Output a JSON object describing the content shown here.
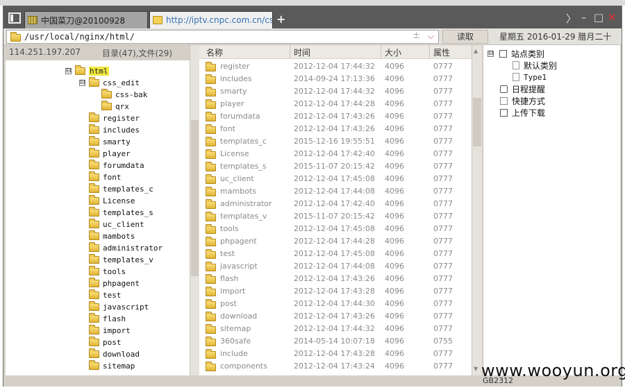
{
  "window": {
    "tabs": [
      {
        "label": "中国菜刀@20100928"
      },
      {
        "label": "http://iptv.cnpc.com.cn/css_..."
      }
    ],
    "new_tab_label": "+",
    "controls": {
      "forward": "〉",
      "minimize": "–",
      "maximize": "□",
      "close": "✕"
    }
  },
  "address_bar": {
    "path": "/usr/local/nginx/html/",
    "mid_symbol": "±",
    "dropdown": "⌵",
    "go_label": "读取",
    "date": "星期五  2016-01-29 腊月二十"
  },
  "info": {
    "ip": "114.251.197.207",
    "counts": "目录(47),文件(29)"
  },
  "tree": {
    "expander": "⊟",
    "items": [
      {
        "label": "html",
        "level": 0,
        "expanded": true,
        "selected": true
      },
      {
        "label": "css_edit",
        "level": 1,
        "expanded": true
      },
      {
        "label": "css-bak",
        "level": 2
      },
      {
        "label": "qrx",
        "level": 2
      },
      {
        "label": "register",
        "level": 1
      },
      {
        "label": "includes",
        "level": 1
      },
      {
        "label": "smarty",
        "level": 1
      },
      {
        "label": "player",
        "level": 1
      },
      {
        "label": "forumdata",
        "level": 1
      },
      {
        "label": "font",
        "level": 1
      },
      {
        "label": "templates_c",
        "level": 1
      },
      {
        "label": "License",
        "level": 1
      },
      {
        "label": "templates_s",
        "level": 1
      },
      {
        "label": "uc_client",
        "level": 1
      },
      {
        "label": "mambots",
        "level": 1
      },
      {
        "label": "administrator",
        "level": 1
      },
      {
        "label": "templates_v",
        "level": 1
      },
      {
        "label": "tools",
        "level": 1
      },
      {
        "label": "phpagent",
        "level": 1
      },
      {
        "label": "test",
        "level": 1
      },
      {
        "label": "javascript",
        "level": 1
      },
      {
        "label": "flash",
        "level": 1
      },
      {
        "label": "import",
        "level": 1
      },
      {
        "label": "post",
        "level": 1
      },
      {
        "label": "download",
        "level": 1
      },
      {
        "label": "sitemap",
        "level": 1
      }
    ]
  },
  "file_list": {
    "columns": {
      "name": "名称",
      "time": "时间",
      "size": "大小",
      "attr": "属性"
    },
    "rows": [
      {
        "name": "register",
        "time": "2012-12-04 17:44:32",
        "size": "4096",
        "attr": "0777"
      },
      {
        "name": "includes",
        "time": "2014-09-24 17:13:36",
        "size": "4096",
        "attr": "0777"
      },
      {
        "name": "smarty",
        "time": "2012-12-04 17:44:32",
        "size": "4096",
        "attr": "0777"
      },
      {
        "name": "player",
        "time": "2012-12-04 17:44:28",
        "size": "4096",
        "attr": "0777"
      },
      {
        "name": "forumdata",
        "time": "2012-12-04 17:43:26",
        "size": "4096",
        "attr": "0777"
      },
      {
        "name": "font",
        "time": "2012-12-04 17:43:26",
        "size": "4096",
        "attr": "0777"
      },
      {
        "name": "templates_c",
        "time": "2015-12-16 19:55:51",
        "size": "4096",
        "attr": "0777"
      },
      {
        "name": "License",
        "time": "2012-12-04 17:42:40",
        "size": "4096",
        "attr": "0777"
      },
      {
        "name": "templates_s",
        "time": "2015-11-07 20:15:42",
        "size": "4096",
        "attr": "0777"
      },
      {
        "name": "uc_client",
        "time": "2012-12-04 17:45:08",
        "size": "4096",
        "attr": "0777"
      },
      {
        "name": "mambots",
        "time": "2012-12-04 17:44:08",
        "size": "4096",
        "attr": "0777"
      },
      {
        "name": "administrator",
        "time": "2012-12-04 17:42:40",
        "size": "4096",
        "attr": "0777"
      },
      {
        "name": "templates_v",
        "time": "2015-11-07 20:15:42",
        "size": "4096",
        "attr": "0777"
      },
      {
        "name": "tools",
        "time": "2012-12-04 17:45:08",
        "size": "4096",
        "attr": "0777"
      },
      {
        "name": "phpagent",
        "time": "2012-12-04 17:44:28",
        "size": "4096",
        "attr": "0777"
      },
      {
        "name": "test",
        "time": "2012-12-04 17:45:08",
        "size": "4096",
        "attr": "0777"
      },
      {
        "name": "javascript",
        "time": "2012-12-04 17:44:08",
        "size": "4096",
        "attr": "0777"
      },
      {
        "name": "flash",
        "time": "2012-12-04 17:43:26",
        "size": "4096",
        "attr": "0777"
      },
      {
        "name": "import",
        "time": "2012-12-04 17:43:28",
        "size": "4096",
        "attr": "0777"
      },
      {
        "name": "post",
        "time": "2012-12-04 17:44:30",
        "size": "4096",
        "attr": "0777"
      },
      {
        "name": "download",
        "time": "2012-12-04 17:43:26",
        "size": "4096",
        "attr": "0777"
      },
      {
        "name": "sitemap",
        "time": "2012-12-04 17:44:32",
        "size": "4096",
        "attr": "0777"
      },
      {
        "name": "360safe",
        "time": "2014-05-14 10:07:18",
        "size": "4096",
        "attr": "0755"
      },
      {
        "name": "include",
        "time": "2012-12-04 17:43:28",
        "size": "4096",
        "attr": "0777"
      },
      {
        "name": "components",
        "time": "2012-12-04 17:43:24",
        "size": "4096",
        "attr": "0777"
      }
    ]
  },
  "right_panel": {
    "site_category": "站点类别",
    "sub_items": [
      "默认类别",
      "Type1"
    ],
    "schedule": "日程提醒",
    "shortcuts": "快捷方式",
    "upload_download": "上传下载"
  },
  "status": {
    "encoding": "GB2312"
  },
  "watermark": "www.wooyun.org",
  "colors": {
    "titlebar": "#5a5a5a",
    "tree_selected": "#f0e63c",
    "folder": "#e8c24a"
  }
}
